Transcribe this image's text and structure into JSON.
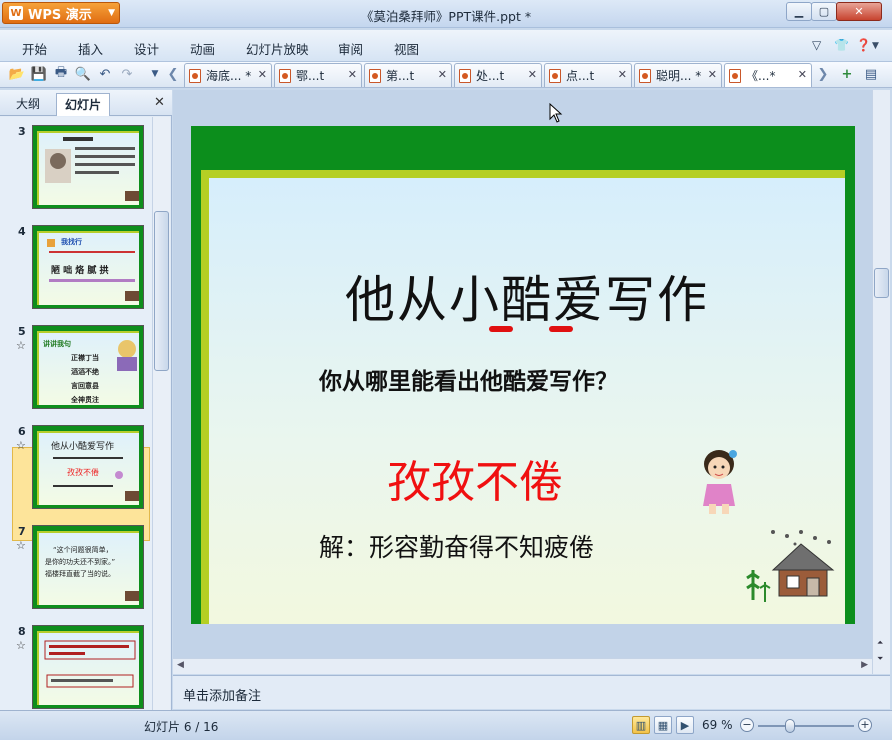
{
  "app": {
    "name": "WPS 演示",
    "window_title": "《莫泊桑拜师》PPT课件.ppt *"
  },
  "menu": [
    "开始",
    "插入",
    "设计",
    "动画",
    "幻灯片放映",
    "审阅",
    "视图"
  ],
  "doc_tabs": [
    {
      "label": "海底... *"
    },
    {
      "label": "鄂...t"
    },
    {
      "label": "第...t"
    },
    {
      "label": "处...t"
    },
    {
      "label": "点...t"
    },
    {
      "label": "聪明... *"
    },
    {
      "label": "《...*"
    }
  ],
  "left_panel": {
    "tabs": [
      "大纲",
      "幻灯片"
    ],
    "thumbnails": [
      {
        "num": "3",
        "star": ""
      },
      {
        "num": "4",
        "star": ""
      },
      {
        "num": "5",
        "star": "☆"
      },
      {
        "num": "6",
        "star": "☆"
      },
      {
        "num": "7",
        "star": "☆"
      },
      {
        "num": "8",
        "star": "☆"
      }
    ],
    "thumb_text": {
      "t4_title": "我找行",
      "t4_row": "陋  咄  烙  腻  拱",
      "t5_title": "讲讲我句",
      "t5_lines": [
        "正襟丁当",
        "滔滔不绝",
        "言回意县",
        "全神贯注"
      ],
      "t6_title": "他从小酷爱写作",
      "t6_idiom": "孜孜不倦",
      "t7_lines": [
        "“这个问题很简单，",
        "是你的功夫还不到家。”",
        "福楼拜直截了当的说。"
      ]
    }
  },
  "slide": {
    "title": "他从小酷爱写作",
    "question": "你从哪里能看出他酷爱写作？",
    "idiom": "孜孜不倦",
    "explanation": "解：形容勤奋得不知疲倦"
  },
  "notes_placeholder": "单击添加备注",
  "status": {
    "slide_indicator": "幻灯片 6 / 16",
    "zoom": "69 %"
  },
  "colors": {
    "slide_green": "#0c8e1c",
    "slide_border": "#b5cf24",
    "idiom_red": "#f01010",
    "wps_orange": "#e06d12"
  }
}
